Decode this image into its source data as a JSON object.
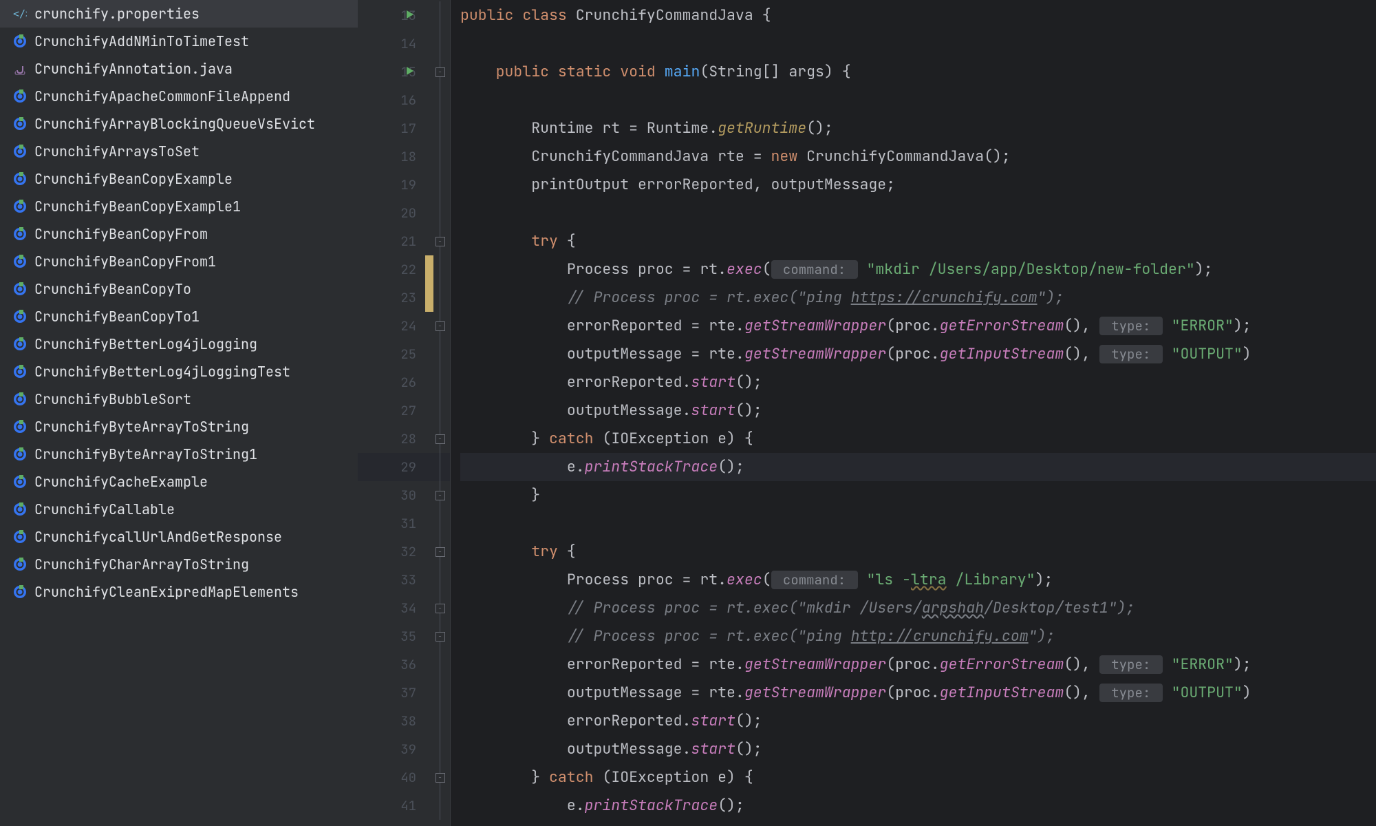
{
  "sidebar": {
    "files": [
      {
        "name": "crunchify.properties",
        "icon": "xml"
      },
      {
        "name": "CrunchifyAddNMinToTimeTest",
        "icon": "class"
      },
      {
        "name": "CrunchifyAnnotation.java",
        "icon": "java"
      },
      {
        "name": "CrunchifyApacheCommonFileAppend",
        "icon": "class"
      },
      {
        "name": "CrunchifyArrayBlockingQueueVsEvict",
        "icon": "class"
      },
      {
        "name": "CrunchifyArraysToSet",
        "icon": "class"
      },
      {
        "name": "CrunchifyBeanCopyExample",
        "icon": "class"
      },
      {
        "name": "CrunchifyBeanCopyExample1",
        "icon": "class"
      },
      {
        "name": "CrunchifyBeanCopyFrom",
        "icon": "class"
      },
      {
        "name": "CrunchifyBeanCopyFrom1",
        "icon": "class"
      },
      {
        "name": "CrunchifyBeanCopyTo",
        "icon": "class"
      },
      {
        "name": "CrunchifyBeanCopyTo1",
        "icon": "class"
      },
      {
        "name": "CrunchifyBetterLog4jLogging",
        "icon": "class"
      },
      {
        "name": "CrunchifyBetterLog4jLoggingTest",
        "icon": "class"
      },
      {
        "name": "CrunchifyBubbleSort",
        "icon": "class"
      },
      {
        "name": "CrunchifyByteArrayToString",
        "icon": "class"
      },
      {
        "name": "CrunchifyByteArrayToString1",
        "icon": "class"
      },
      {
        "name": "CrunchifyCacheExample",
        "icon": "class"
      },
      {
        "name": "CrunchifyCallable",
        "icon": "class"
      },
      {
        "name": "CrunchifycallUrlAndGetResponse",
        "icon": "class"
      },
      {
        "name": "CrunchifyCharArrayToString",
        "icon": "class"
      },
      {
        "name": "CrunchifyCleanExipredMapElements",
        "icon": "class"
      }
    ]
  },
  "gutter": {
    "start": 13,
    "end": 41,
    "run_markers": [
      13,
      15
    ],
    "change_bars": [
      22,
      23
    ],
    "highlighted": 29,
    "folds_open": [
      15,
      21,
      24,
      32,
      34,
      35,
      40
    ],
    "folds_close": [
      28,
      30
    ]
  },
  "code": {
    "l13": {
      "public": "public",
      "class": "class",
      "name": "CrunchifyCommandJava",
      "brace": " {"
    },
    "l15": {
      "public": "public",
      "static": "static",
      "void": "void",
      "main": "main",
      "params": "(String[] args) {"
    },
    "l17": {
      "t1": "Runtime rt = Runtime.",
      "m": "getRuntime",
      "t2": "();"
    },
    "l18": {
      "t1": "CrunchifyCommandJava rte = ",
      "new": "new",
      "t2": " CrunchifyCommandJava();"
    },
    "l19": {
      "t1": "printOutput errorReported, outputMessage;"
    },
    "l21": {
      "try": "try",
      "brace": " {"
    },
    "l22": {
      "t1": "Process proc = rt.",
      "m": "exec",
      "lp": "(",
      "hint": " command: ",
      "str": "\"mkdir /Users/app/Desktop/new-folder\"",
      "rp": ");"
    },
    "l23": {
      "c1": "// Process proc = rt.exec(\"ping ",
      "c2": "https://crunchify.com",
      "c3": "\");"
    },
    "l24": {
      "t1": "errorReported = rte.",
      "m": "getStreamWrapper",
      "t2": "(proc.",
      "m2": "getErrorStream",
      "t3": "(), ",
      "hint": " type: ",
      "str": "\"ERROR\"",
      "rp": ");"
    },
    "l25": {
      "t1": "outputMessage = rte.",
      "m": "getStreamWrapper",
      "t2": "(proc.",
      "m2": "getInputStream",
      "t3": "(), ",
      "hint": " type: ",
      "str": "\"OUTPUT\"",
      "rp": ")"
    },
    "l26": {
      "t1": "errorReported.",
      "m": "start",
      "t2": "();"
    },
    "l27": {
      "t1": "outputMessage.",
      "m": "start",
      "t2": "();"
    },
    "l28": {
      "rb": "}",
      "catch": " catch ",
      "t1": "(IOException e) {"
    },
    "l29": {
      "t1": "e.",
      "m": "printStackTrace",
      "t2": "();"
    },
    "l30": {
      "rb": "}"
    },
    "l32": {
      "try": "try",
      "brace": " {"
    },
    "l33": {
      "t1": "Process proc = rt.",
      "m": "exec",
      "lp": "(",
      "hint": " command: ",
      "str1": "\"ls -",
      "warn": "ltra",
      "str2": " /Library\"",
      "rp": ");"
    },
    "l34": {
      "c1": "// Process proc = rt.exec(\"mkdir /Users/",
      "c2": "arpshah",
      "c3": "/Desktop/test1\");"
    },
    "l35": {
      "c1": "// Process proc = rt.exec(\"ping ",
      "c2": "http://crunchify.com",
      "c3": "\");"
    },
    "l36": {
      "t1": "errorReported = rte.",
      "m": "getStreamWrapper",
      "t2": "(proc.",
      "m2": "getErrorStream",
      "t3": "(), ",
      "hint": " type: ",
      "str": "\"ERROR\"",
      "rp": ");"
    },
    "l37": {
      "t1": "outputMessage = rte.",
      "m": "getStreamWrapper",
      "t2": "(proc.",
      "m2": "getInputStream",
      "t3": "(), ",
      "hint": " type: ",
      "str": "\"OUTPUT\"",
      "rp": ")"
    },
    "l38": {
      "t1": "errorReported.",
      "m": "start",
      "t2": "();"
    },
    "l39": {
      "t1": "outputMessage.",
      "m": "start",
      "t2": "();"
    },
    "l40": {
      "rb": "}",
      "catch": " catch ",
      "t1": "(IOException e) {"
    },
    "l41": {
      "t1": "e.",
      "m": "printStackTrace",
      "t2": "();"
    }
  }
}
